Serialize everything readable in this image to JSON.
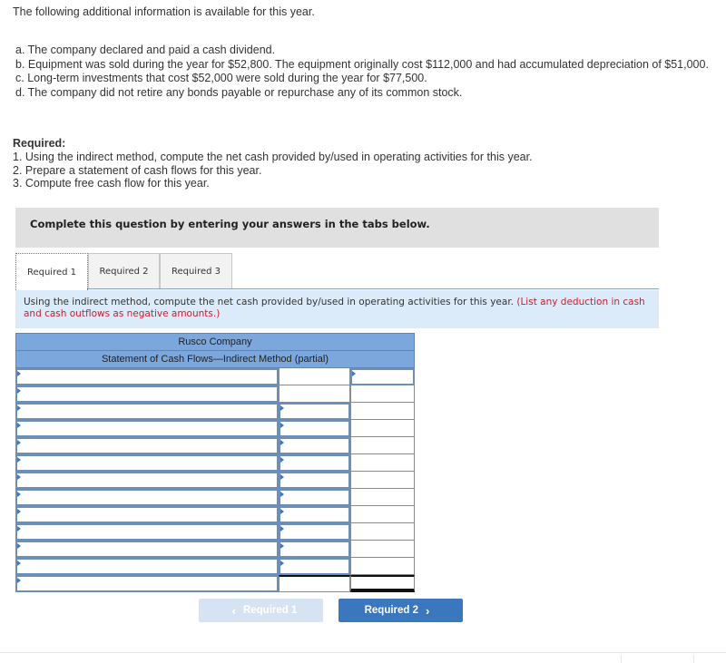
{
  "intro": "The following additional information is available for this year.",
  "info_items": [
    "a. The company declared and paid a cash dividend.",
    "b. Equipment was sold during the year for $52,800. The equipment originally cost $112,000 and had accumulated depreciation of $51,000.",
    "c. Long-term investments that cost $52,000 were sold during the year for $77,500.",
    "d. The company did not retire any bonds payable or repurchase any of its common stock."
  ],
  "required": {
    "heading": "Required:",
    "items": [
      "1. Using the indirect method, compute the net cash provided by/used in operating activities for this year.",
      "2. Prepare a statement of cash flows for this year.",
      "3. Compute free cash flow for this year."
    ]
  },
  "banner": "Complete this question by entering your answers in the tabs below.",
  "tabs": [
    {
      "label": "Required 1",
      "active": true
    },
    {
      "label": "Required 2",
      "active": false
    },
    {
      "label": "Required 3",
      "active": false
    }
  ],
  "instruction": {
    "text": "Using the indirect method, compute the net cash provided by/used in operating activities for this year.",
    "note": "(List any deduction in cash and cash outflows as negative amounts.)"
  },
  "table": {
    "company": "Rusco Company",
    "title": "Statement of Cash Flows—Indirect Method (partial)",
    "rows": [
      {
        "label": "",
        "amount": "",
        "total": ""
      },
      {
        "label": "",
        "amount": "",
        "total": ""
      },
      {
        "label": "",
        "amount": "",
        "total": ""
      },
      {
        "label": "",
        "amount": "",
        "total": ""
      },
      {
        "label": "",
        "amount": "",
        "total": ""
      },
      {
        "label": "",
        "amount": "",
        "total": ""
      },
      {
        "label": "",
        "amount": "",
        "total": ""
      },
      {
        "label": "",
        "amount": "",
        "total": ""
      },
      {
        "label": "",
        "amount": "",
        "total": ""
      },
      {
        "label": "",
        "amount": "",
        "total": ""
      },
      {
        "label": "",
        "amount": "",
        "total": ""
      },
      {
        "label": "",
        "amount": "",
        "total": ""
      },
      {
        "label": "",
        "amount": "",
        "total": ""
      }
    ]
  },
  "nav": {
    "prev_label": "Required 1",
    "next_label": "Required 2",
    "prev_icon": "chevron-left-icon",
    "next_icon": "chevron-right-icon"
  },
  "colors": {
    "header_blue": "#7ba7dd",
    "input_border": "#6b8fb8",
    "next_button": "#3a77bf",
    "prev_button_disabled": "#d6e3f2",
    "note_red": "#c8202e",
    "instruction_bg": "#dcebf9",
    "banner_bg": "#e0e0e0"
  }
}
